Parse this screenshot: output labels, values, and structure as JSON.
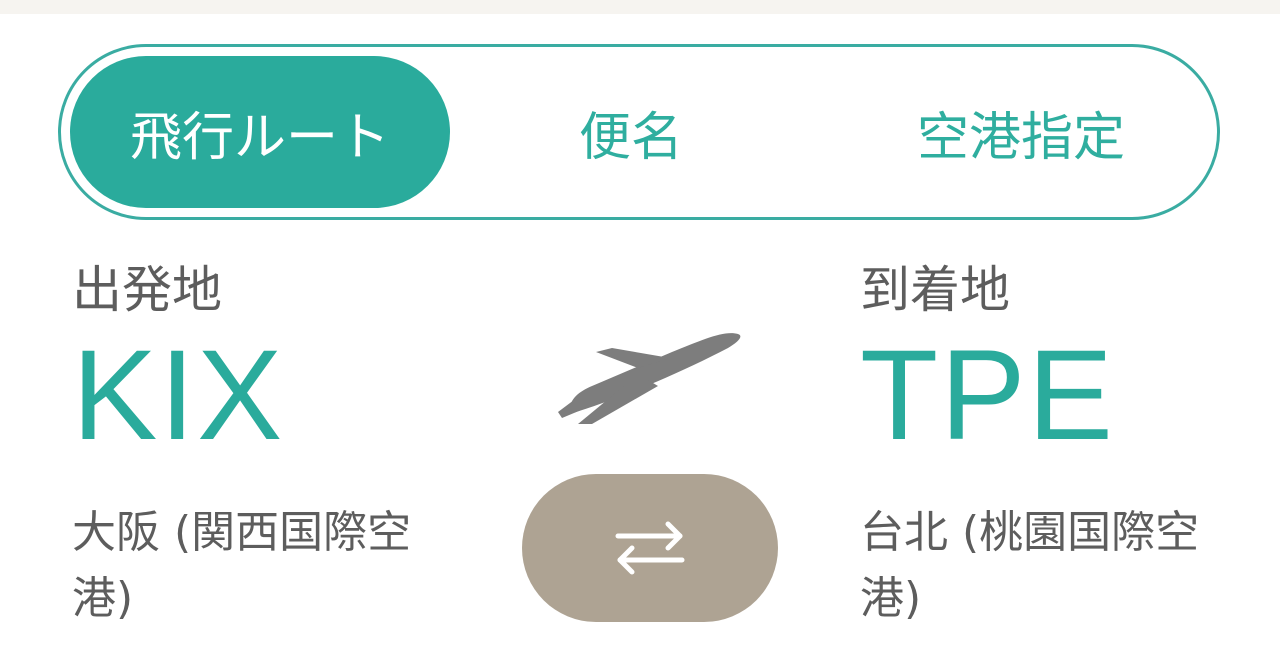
{
  "tabs": [
    {
      "label": "飛行ルート",
      "active": true
    },
    {
      "label": "便名",
      "active": false
    },
    {
      "label": "空港指定",
      "active": false
    }
  ],
  "origin": {
    "label": "出発地",
    "code": "KIX",
    "name": "大阪 (関西国際空港)"
  },
  "destination": {
    "label": "到着地",
    "code": "TPE",
    "name": "台北 (桃園国際空港)"
  },
  "icons": {
    "route": "airplane-takeoff-icon",
    "swap": "swap-arrows-icon"
  },
  "colors": {
    "accent": "#2aab9c",
    "swap_button": "#aea393",
    "plane": "#7d7d7d",
    "text": "#5d5d5d"
  }
}
